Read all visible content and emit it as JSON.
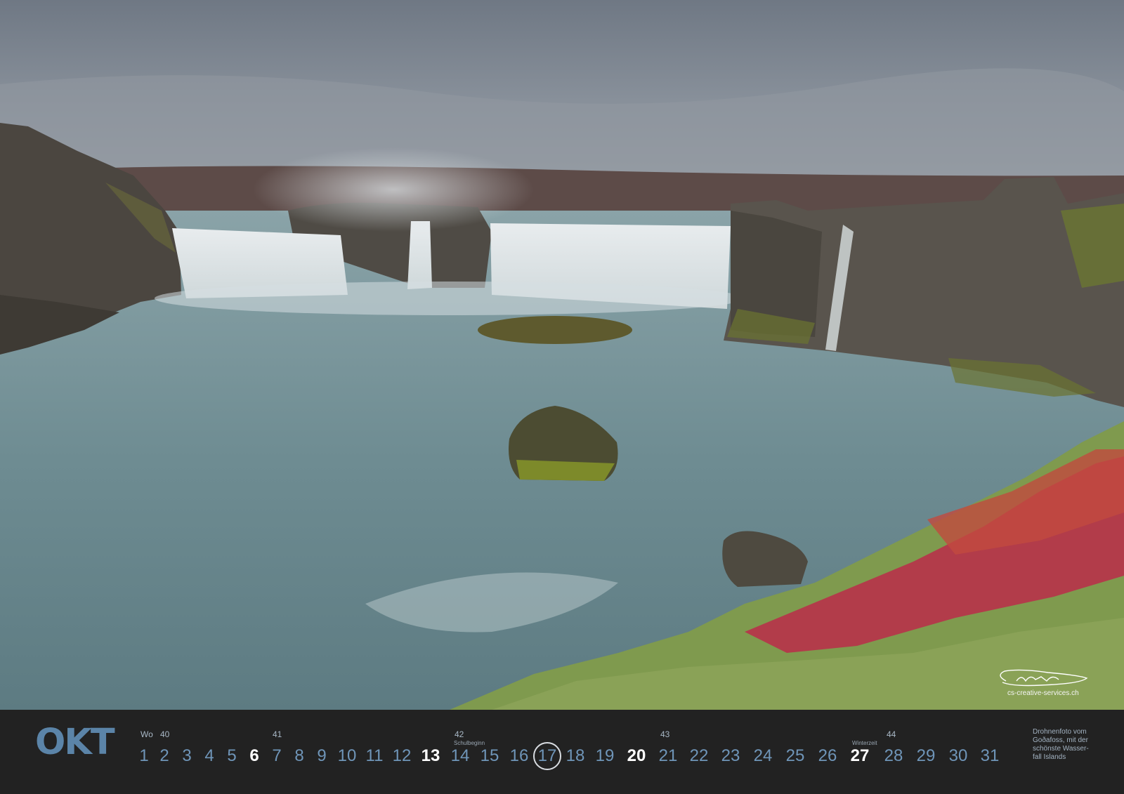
{
  "photo": {
    "subject": "Goðafoss waterfall",
    "colors": {
      "sky": "#7f8792",
      "water": "#6f8c92",
      "rock": "#4d4840",
      "moss": "#7a8a2e",
      "foliage_red": "#b8324a",
      "foliage_green": "#7f9a4e"
    }
  },
  "signature": {
    "url": "cs-creative-services.ch"
  },
  "calendar": {
    "month": "OKT",
    "week_label": "Wo",
    "weeks": [
      "40",
      "41",
      "42",
      "43",
      "44"
    ],
    "notes": {
      "school_start": "Schulbeginn",
      "winter_time": "Winterzeit"
    },
    "days": [
      "1",
      "2",
      "3",
      "4",
      "5",
      "6",
      "7",
      "8",
      "9",
      "10",
      "11",
      "12",
      "13",
      "14",
      "15",
      "16",
      "17",
      "18",
      "19",
      "20",
      "21",
      "22",
      "23",
      "24",
      "25",
      "26",
      "27",
      "28",
      "29",
      "30",
      "31"
    ],
    "sundays": [
      "6",
      "13",
      "20",
      "27"
    ],
    "today": "17",
    "caption": [
      "Drohnenfoto vom",
      "Goðafoss, mit der",
      "schönste Wasser-",
      "fall Islands"
    ]
  }
}
